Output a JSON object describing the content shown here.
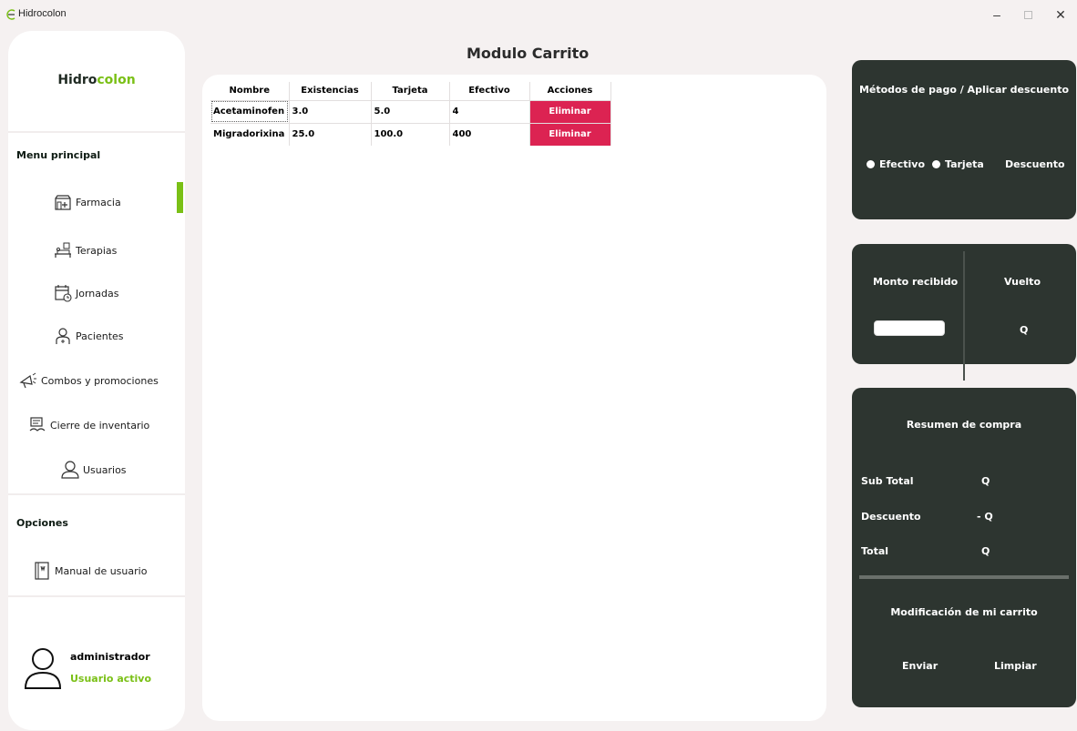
{
  "window": {
    "title": "Hidrocolon",
    "min_glyph": "–",
    "close_glyph": "✕"
  },
  "brand": {
    "part1": "Hidro",
    "part2": "colon"
  },
  "sidebar": {
    "menu_title": "Menu principal",
    "items": [
      {
        "label": "Farmacia",
        "icon": "pharmacy-icon"
      },
      {
        "label": "Terapias",
        "icon": "therapy-bed-icon"
      },
      {
        "label": "Jornadas",
        "icon": "calendar-clock-icon"
      },
      {
        "label": "Pacientes",
        "icon": "patient-icon"
      },
      {
        "label": "Combos y promociones",
        "icon": "megaphone-icon"
      },
      {
        "label": "Cierre de inventario",
        "icon": "inventory-icon"
      },
      {
        "label": "Usuarios",
        "icon": "user-icon"
      }
    ],
    "options_title": "Opciones",
    "options": [
      {
        "label": "Manual de usuario",
        "icon": "manual-icon"
      }
    ],
    "user": {
      "name": "administrador",
      "status": "Usuario activo"
    }
  },
  "main": {
    "title": "Modulo Carrito",
    "table": {
      "headers": [
        "Nombre",
        "Existencias",
        "Tarjeta",
        "Efectivo",
        "Acciones"
      ],
      "rows": [
        {
          "nombre": "Acetaminofen",
          "existencias": "3.0",
          "tarjeta": "5.0",
          "efectivo": "4",
          "accion": "Eliminar"
        },
        {
          "nombre": "Migradorixina",
          "existencias": "25.0",
          "tarjeta": "100.0",
          "efectivo": "400",
          "accion": "Eliminar"
        }
      ]
    }
  },
  "payment": {
    "title": "Métodos de pago / Aplicar descuento",
    "efectivo": "Efectivo",
    "tarjeta": "Tarjeta",
    "descuento": "Descuento"
  },
  "cash": {
    "received_label": "Monto recibido",
    "change_label": "Vuelto",
    "change_value": "Q"
  },
  "summary": {
    "title": "Resumen de compra",
    "subtotal_label": "Sub Total",
    "subtotal_value": "Q",
    "discount_label": "Descuento",
    "discount_value": "- Q",
    "total_label": "Total",
    "total_value": "Q",
    "modify_title": "Modificación de mi carrito",
    "send": "Enviar",
    "clear": "Limpiar"
  },
  "colors": {
    "accent": "#7ac016",
    "danger": "#dc2352",
    "card": "#2d3530"
  }
}
